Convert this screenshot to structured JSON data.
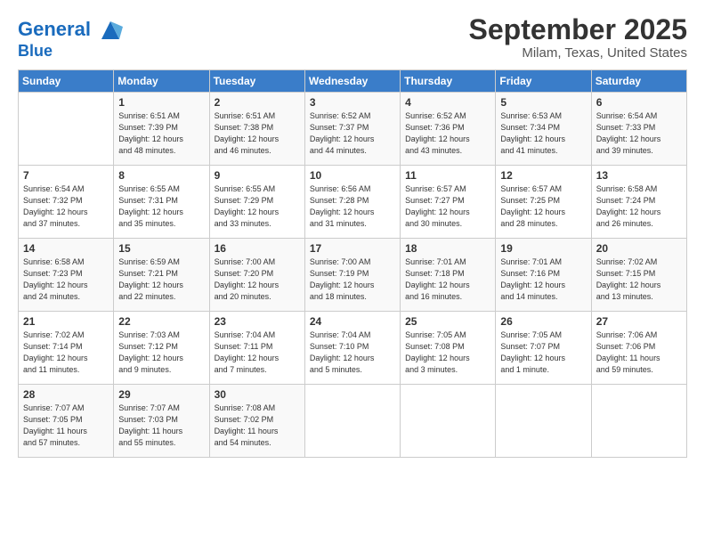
{
  "header": {
    "logo_line1": "General",
    "logo_line2": "Blue",
    "month_title": "September 2025",
    "location": "Milam, Texas, United States"
  },
  "days_of_week": [
    "Sunday",
    "Monday",
    "Tuesday",
    "Wednesday",
    "Thursday",
    "Friday",
    "Saturday"
  ],
  "weeks": [
    [
      {
        "day": "",
        "info": ""
      },
      {
        "day": "1",
        "info": "Sunrise: 6:51 AM\nSunset: 7:39 PM\nDaylight: 12 hours\nand 48 minutes."
      },
      {
        "day": "2",
        "info": "Sunrise: 6:51 AM\nSunset: 7:38 PM\nDaylight: 12 hours\nand 46 minutes."
      },
      {
        "day": "3",
        "info": "Sunrise: 6:52 AM\nSunset: 7:37 PM\nDaylight: 12 hours\nand 44 minutes."
      },
      {
        "day": "4",
        "info": "Sunrise: 6:52 AM\nSunset: 7:36 PM\nDaylight: 12 hours\nand 43 minutes."
      },
      {
        "day": "5",
        "info": "Sunrise: 6:53 AM\nSunset: 7:34 PM\nDaylight: 12 hours\nand 41 minutes."
      },
      {
        "day": "6",
        "info": "Sunrise: 6:54 AM\nSunset: 7:33 PM\nDaylight: 12 hours\nand 39 minutes."
      }
    ],
    [
      {
        "day": "7",
        "info": "Sunrise: 6:54 AM\nSunset: 7:32 PM\nDaylight: 12 hours\nand 37 minutes."
      },
      {
        "day": "8",
        "info": "Sunrise: 6:55 AM\nSunset: 7:31 PM\nDaylight: 12 hours\nand 35 minutes."
      },
      {
        "day": "9",
        "info": "Sunrise: 6:55 AM\nSunset: 7:29 PM\nDaylight: 12 hours\nand 33 minutes."
      },
      {
        "day": "10",
        "info": "Sunrise: 6:56 AM\nSunset: 7:28 PM\nDaylight: 12 hours\nand 31 minutes."
      },
      {
        "day": "11",
        "info": "Sunrise: 6:57 AM\nSunset: 7:27 PM\nDaylight: 12 hours\nand 30 minutes."
      },
      {
        "day": "12",
        "info": "Sunrise: 6:57 AM\nSunset: 7:25 PM\nDaylight: 12 hours\nand 28 minutes."
      },
      {
        "day": "13",
        "info": "Sunrise: 6:58 AM\nSunset: 7:24 PM\nDaylight: 12 hours\nand 26 minutes."
      }
    ],
    [
      {
        "day": "14",
        "info": "Sunrise: 6:58 AM\nSunset: 7:23 PM\nDaylight: 12 hours\nand 24 minutes."
      },
      {
        "day": "15",
        "info": "Sunrise: 6:59 AM\nSunset: 7:21 PM\nDaylight: 12 hours\nand 22 minutes."
      },
      {
        "day": "16",
        "info": "Sunrise: 7:00 AM\nSunset: 7:20 PM\nDaylight: 12 hours\nand 20 minutes."
      },
      {
        "day": "17",
        "info": "Sunrise: 7:00 AM\nSunset: 7:19 PM\nDaylight: 12 hours\nand 18 minutes."
      },
      {
        "day": "18",
        "info": "Sunrise: 7:01 AM\nSunset: 7:18 PM\nDaylight: 12 hours\nand 16 minutes."
      },
      {
        "day": "19",
        "info": "Sunrise: 7:01 AM\nSunset: 7:16 PM\nDaylight: 12 hours\nand 14 minutes."
      },
      {
        "day": "20",
        "info": "Sunrise: 7:02 AM\nSunset: 7:15 PM\nDaylight: 12 hours\nand 13 minutes."
      }
    ],
    [
      {
        "day": "21",
        "info": "Sunrise: 7:02 AM\nSunset: 7:14 PM\nDaylight: 12 hours\nand 11 minutes."
      },
      {
        "day": "22",
        "info": "Sunrise: 7:03 AM\nSunset: 7:12 PM\nDaylight: 12 hours\nand 9 minutes."
      },
      {
        "day": "23",
        "info": "Sunrise: 7:04 AM\nSunset: 7:11 PM\nDaylight: 12 hours\nand 7 minutes."
      },
      {
        "day": "24",
        "info": "Sunrise: 7:04 AM\nSunset: 7:10 PM\nDaylight: 12 hours\nand 5 minutes."
      },
      {
        "day": "25",
        "info": "Sunrise: 7:05 AM\nSunset: 7:08 PM\nDaylight: 12 hours\nand 3 minutes."
      },
      {
        "day": "26",
        "info": "Sunrise: 7:05 AM\nSunset: 7:07 PM\nDaylight: 12 hours\nand 1 minute."
      },
      {
        "day": "27",
        "info": "Sunrise: 7:06 AM\nSunset: 7:06 PM\nDaylight: 11 hours\nand 59 minutes."
      }
    ],
    [
      {
        "day": "28",
        "info": "Sunrise: 7:07 AM\nSunset: 7:05 PM\nDaylight: 11 hours\nand 57 minutes."
      },
      {
        "day": "29",
        "info": "Sunrise: 7:07 AM\nSunset: 7:03 PM\nDaylight: 11 hours\nand 55 minutes."
      },
      {
        "day": "30",
        "info": "Sunrise: 7:08 AM\nSunset: 7:02 PM\nDaylight: 11 hours\nand 54 minutes."
      },
      {
        "day": "",
        "info": ""
      },
      {
        "day": "",
        "info": ""
      },
      {
        "day": "",
        "info": ""
      },
      {
        "day": "",
        "info": ""
      }
    ]
  ]
}
